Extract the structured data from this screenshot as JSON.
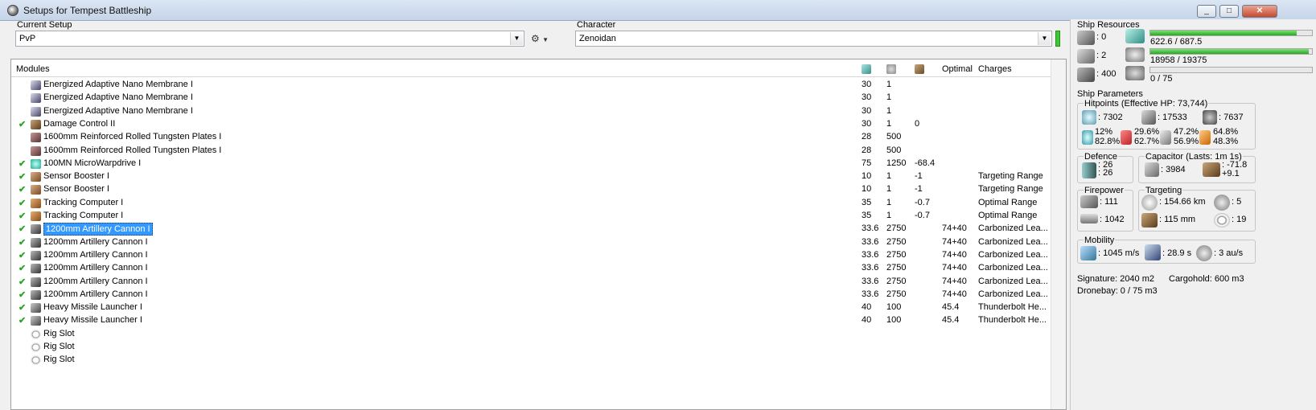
{
  "window": {
    "title": "Setups for Tempest Battleship"
  },
  "current_setup": {
    "label": "Current Setup",
    "value": "PvP"
  },
  "character": {
    "label": "Character",
    "value": "Zenoidan"
  },
  "table": {
    "headers": {
      "modules": "Modules",
      "optimal": "Optimal",
      "charges": "Charges"
    },
    "header_icons": [
      "cpu-icon",
      "powergrid-icon",
      "capacitor-icon"
    ],
    "rows": [
      {
        "check": "",
        "icon": "armor-membrane-icon",
        "name": "Energized Adaptive Nano Membrane I",
        "cpu": "30",
        "pg": "1",
        "cap": "",
        "optimal": "",
        "charges": ""
      },
      {
        "check": "",
        "icon": "armor-membrane-icon",
        "name": "Energized Adaptive Nano Membrane I",
        "cpu": "30",
        "pg": "1",
        "cap": "",
        "optimal": "",
        "charges": ""
      },
      {
        "check": "",
        "icon": "armor-membrane-icon",
        "name": "Energized Adaptive Nano Membrane I",
        "cpu": "30",
        "pg": "1",
        "cap": "",
        "optimal": "",
        "charges": ""
      },
      {
        "check": "✔",
        "icon": "damage-control-icon",
        "name": "Damage Control II",
        "cpu": "30",
        "pg": "1",
        "cap": "0",
        "optimal": "",
        "charges": ""
      },
      {
        "check": "",
        "icon": "armor-plate-icon",
        "name": "1600mm Reinforced Rolled Tungsten Plates I",
        "cpu": "28",
        "pg": "500",
        "cap": "",
        "optimal": "",
        "charges": ""
      },
      {
        "check": "",
        "icon": "armor-plate-icon",
        "name": "1600mm Reinforced Rolled Tungsten Plates I",
        "cpu": "28",
        "pg": "500",
        "cap": "",
        "optimal": "",
        "charges": ""
      },
      {
        "check": "✔",
        "icon": "microwarpdrive-icon",
        "name": "100MN MicroWarpdrive I",
        "cpu": "75",
        "pg": "1250",
        "cap": "-68.4",
        "optimal": "",
        "charges": ""
      },
      {
        "check": "✔",
        "icon": "sensor-booster-icon",
        "name": "Sensor Booster I",
        "cpu": "10",
        "pg": "1",
        "cap": "-1",
        "optimal": "",
        "charges": "Targeting Range"
      },
      {
        "check": "✔",
        "icon": "sensor-booster-icon",
        "name": "Sensor Booster I",
        "cpu": "10",
        "pg": "1",
        "cap": "-1",
        "optimal": "",
        "charges": "Targeting Range"
      },
      {
        "check": "✔",
        "icon": "tracking-computer-icon",
        "name": "Tracking Computer I",
        "cpu": "35",
        "pg": "1",
        "cap": "-0.7",
        "optimal": "",
        "charges": "Optimal Range"
      },
      {
        "check": "✔",
        "icon": "tracking-computer-icon",
        "name": "Tracking Computer I",
        "cpu": "35",
        "pg": "1",
        "cap": "-0.7",
        "optimal": "",
        "charges": "Optimal Range"
      },
      {
        "check": "✔",
        "icon": "artillery-icon",
        "name": "1200mm Artillery Cannon I",
        "cpu": "33.6",
        "pg": "2750",
        "cap": "",
        "optimal": "74+40",
        "charges": "Carbonized Lea...",
        "selected": true
      },
      {
        "check": "✔",
        "icon": "artillery-icon",
        "name": "1200mm Artillery Cannon I",
        "cpu": "33.6",
        "pg": "2750",
        "cap": "",
        "optimal": "74+40",
        "charges": "Carbonized Lea..."
      },
      {
        "check": "✔",
        "icon": "artillery-icon",
        "name": "1200mm Artillery Cannon I",
        "cpu": "33.6",
        "pg": "2750",
        "cap": "",
        "optimal": "74+40",
        "charges": "Carbonized Lea..."
      },
      {
        "check": "✔",
        "icon": "artillery-icon",
        "name": "1200mm Artillery Cannon I",
        "cpu": "33.6",
        "pg": "2750",
        "cap": "",
        "optimal": "74+40",
        "charges": "Carbonized Lea..."
      },
      {
        "check": "✔",
        "icon": "artillery-icon",
        "name": "1200mm Artillery Cannon I",
        "cpu": "33.6",
        "pg": "2750",
        "cap": "",
        "optimal": "74+40",
        "charges": "Carbonized Lea..."
      },
      {
        "check": "✔",
        "icon": "artillery-icon",
        "name": "1200mm Artillery Cannon I",
        "cpu": "33.6",
        "pg": "2750",
        "cap": "",
        "optimal": "74+40",
        "charges": "Carbonized Lea..."
      },
      {
        "check": "✔",
        "icon": "missile-launcher-icon",
        "name": "Heavy Missile Launcher I",
        "cpu": "40",
        "pg": "100",
        "cap": "",
        "optimal": "45.4",
        "charges": "Thunderbolt He..."
      },
      {
        "check": "✔",
        "icon": "missile-launcher-icon",
        "name": "Heavy Missile Launcher I",
        "cpu": "40",
        "pg": "100",
        "cap": "",
        "optimal": "45.4",
        "charges": "Thunderbolt He..."
      },
      {
        "check": "",
        "icon": "rig-slot-icon",
        "name": "Rig Slot",
        "cpu": "",
        "pg": "",
        "cap": "",
        "optimal": "",
        "charges": ""
      },
      {
        "check": "",
        "icon": "rig-slot-icon",
        "name": "Rig Slot",
        "cpu": "",
        "pg": "",
        "cap": "",
        "optimal": "",
        "charges": ""
      },
      {
        "check": "",
        "icon": "rig-slot-icon",
        "name": "Rig Slot",
        "cpu": "",
        "pg": "",
        "cap": "",
        "optimal": "",
        "charges": ""
      }
    ]
  },
  "ship_resources": {
    "title": "Ship Resources",
    "hardpoints": [
      ": 0",
      ": 2",
      ": 400"
    ],
    "cpu": {
      "text": "622.6 / 687.5",
      "fraction": 0.906
    },
    "powergrid": {
      "text": "18958 / 19375",
      "fraction": 0.978
    },
    "calibration": {
      "text": "0 / 75",
      "fraction": 0
    }
  },
  "ship_parameters": {
    "title": "Ship Parameters",
    "hitpoints_title": "Hitpoints (Effective HP: 73,744)",
    "shield_hp": ": 7302",
    "armor_hp": ": 17533",
    "hull_hp": ": 7637",
    "res_em": "12%",
    "res_em2": "82.8%",
    "res_therm": "29.6%",
    "res_therm2": "62.7%",
    "res_kin": "47.2%",
    "res_kin2": "56.9%",
    "res_exp": "64.8%",
    "res_exp2": "48.3%",
    "defence_title": "Defence",
    "defence_1": ": 26",
    "defence_2": ": 26",
    "capacitor_title": "Capacitor (Lasts: 1m 1s)",
    "capacitor_amount": ": 3984",
    "capacitor_delta": ": -71.8",
    "capacitor_delta2": "+9.1",
    "firepower_title": "Firepower",
    "firepower_1": ": 111",
    "firepower_2": ": 1042",
    "targeting_title": "Targeting",
    "target_range": ": 154.66 km",
    "max_targets": ": 5",
    "scan_res": ": 115 mm",
    "sensor_strength": ": 19",
    "mobility_title": "Mobility",
    "speed": ": 1045 m/s",
    "align_time": ": 28.9 s",
    "warp_speed": ": 3 au/s",
    "signature": "Signature: 2040 m2",
    "cargohold": "Cargohold: 600 m3",
    "dronebay": "Dronebay: 0 / 75 m3"
  }
}
